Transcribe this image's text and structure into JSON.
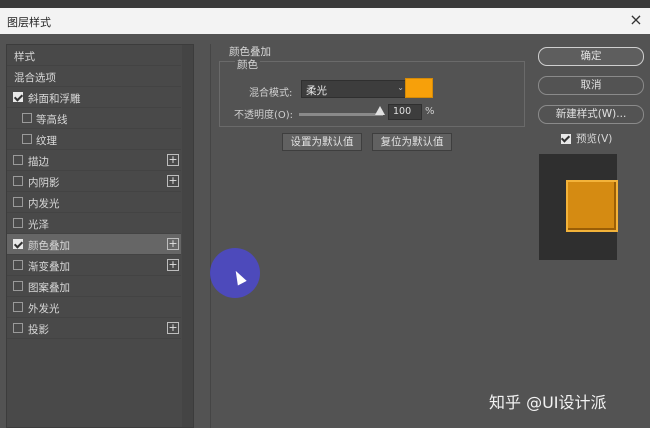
{
  "dialog": {
    "title": "图层样式",
    "close_glyph": "×"
  },
  "left_panel": {
    "header": "样式",
    "blend_options": "混合选项",
    "items": [
      {
        "label": "斜面和浮雕",
        "checked": true,
        "indent": false,
        "plus": false,
        "selected": false
      },
      {
        "label": "等高线",
        "checked": false,
        "indent": true,
        "plus": false,
        "selected": false
      },
      {
        "label": "纹理",
        "checked": false,
        "indent": true,
        "plus": false,
        "selected": false
      },
      {
        "label": "描边",
        "checked": false,
        "indent": false,
        "plus": true,
        "selected": false
      },
      {
        "label": "内阴影",
        "checked": false,
        "indent": false,
        "plus": true,
        "selected": false
      },
      {
        "label": "内发光",
        "checked": false,
        "indent": false,
        "plus": false,
        "selected": false
      },
      {
        "label": "光泽",
        "checked": false,
        "indent": false,
        "plus": false,
        "selected": false
      },
      {
        "label": "颜色叠加",
        "checked": true,
        "indent": false,
        "plus": true,
        "selected": true
      },
      {
        "label": "渐变叠加",
        "checked": false,
        "indent": false,
        "plus": true,
        "selected": false
      },
      {
        "label": "图案叠加",
        "checked": false,
        "indent": false,
        "plus": false,
        "selected": false
      },
      {
        "label": "外发光",
        "checked": false,
        "indent": false,
        "plus": false,
        "selected": false
      },
      {
        "label": "投影",
        "checked": false,
        "indent": false,
        "plus": true,
        "selected": false
      }
    ],
    "plus_glyph": "+"
  },
  "color_overlay": {
    "section_title": "颜色叠加",
    "group_title": "颜色",
    "blend_mode_label": "混合模式:",
    "blend_mode_value": "柔光",
    "caret_glyph": "⌄",
    "swatch_color": "#f7a00a",
    "opacity_label": "不透明度(O):",
    "opacity_value": "100",
    "opacity_unit": "%",
    "opacity_fraction": 1.0,
    "set_default_button": "设置为默认值",
    "reset_default_button": "复位为默认值"
  },
  "right_panel": {
    "ok_button": "确定",
    "cancel_button": "取消",
    "new_style_button": "新建样式(W)...",
    "preview_label": "预览(V)",
    "preview_checked": true,
    "preview_color": "#d58b12"
  },
  "watermark": "知乎 @UI设计派",
  "cursor_highlight_color": "#4c48d2"
}
